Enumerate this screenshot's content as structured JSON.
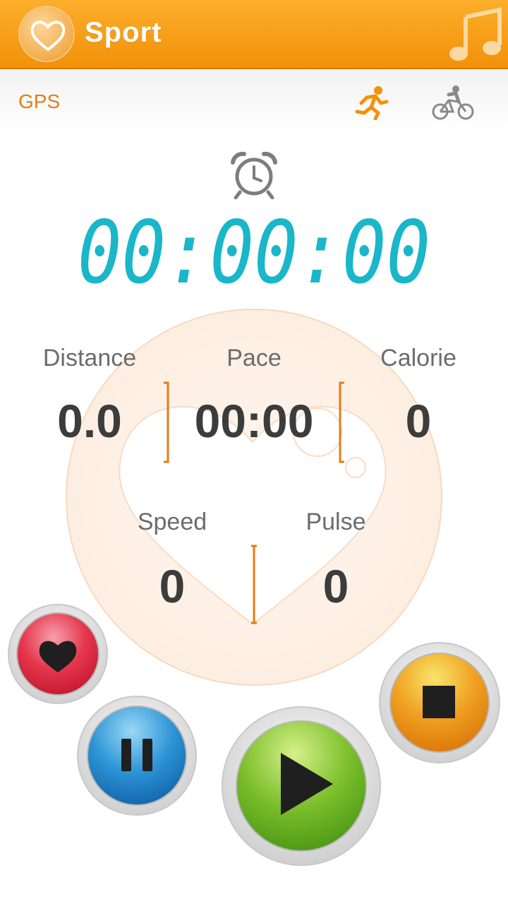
{
  "header": {
    "title": "Sport",
    "logo_icon": "heart-icon",
    "music_icon": "music-note-icon"
  },
  "modebar": {
    "gps_label": "GPS",
    "run_icon": "running-icon",
    "bike_icon": "cycling-icon"
  },
  "timer": {
    "value": "00:00:00",
    "color": "#1ab6c9"
  },
  "stats": {
    "distance": {
      "label": "Distance",
      "value": "0.0"
    },
    "pace": {
      "label": "Pace",
      "value": "00:00"
    },
    "calorie": {
      "label": "Calorie",
      "value": "0"
    },
    "speed": {
      "label": "Speed",
      "value": "0"
    },
    "pulse": {
      "label": "Pulse",
      "value": "0"
    }
  },
  "controls": {
    "heart_button_icon": "heart-icon",
    "pause_button_icon": "pause-icon",
    "play_button_icon": "play-icon",
    "stop_button_icon": "stop-icon"
  },
  "colors": {
    "accent": "#f39109",
    "label": "#6c6c6c",
    "value": "#3c3c3c",
    "divider": "#e47c16"
  }
}
